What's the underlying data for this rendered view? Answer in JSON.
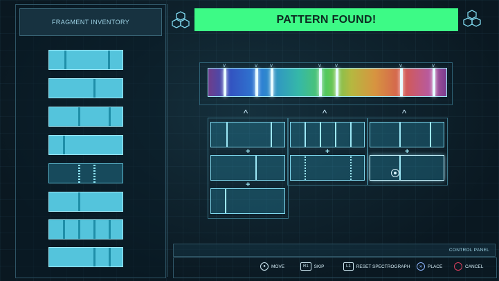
{
  "inventory": {
    "title": "FRAGMENT INVENTORY"
  },
  "banner": {
    "text": "PATTERN FOUND!"
  },
  "control_panel": {
    "title": "CONTROL PANEL",
    "controls": [
      {
        "button": "◯",
        "label": "MOVE"
      },
      {
        "button": "R1",
        "label": "SKIP"
      },
      {
        "button": "L1",
        "label": "RESET SPECTROGRAPH"
      },
      {
        "button": "✕",
        "label": "PLACE"
      },
      {
        "button": "◯",
        "label": "CANCEL"
      }
    ]
  },
  "colors": {
    "accent": "#3dfa86",
    "cyan": "#54c4dc",
    "cancel": "#e04060"
  },
  "icons": {
    "hex_left": "hexagon-cluster-icon",
    "hex_right": "hexagon-cluster-icon",
    "cursor": "target-cursor-icon"
  }
}
